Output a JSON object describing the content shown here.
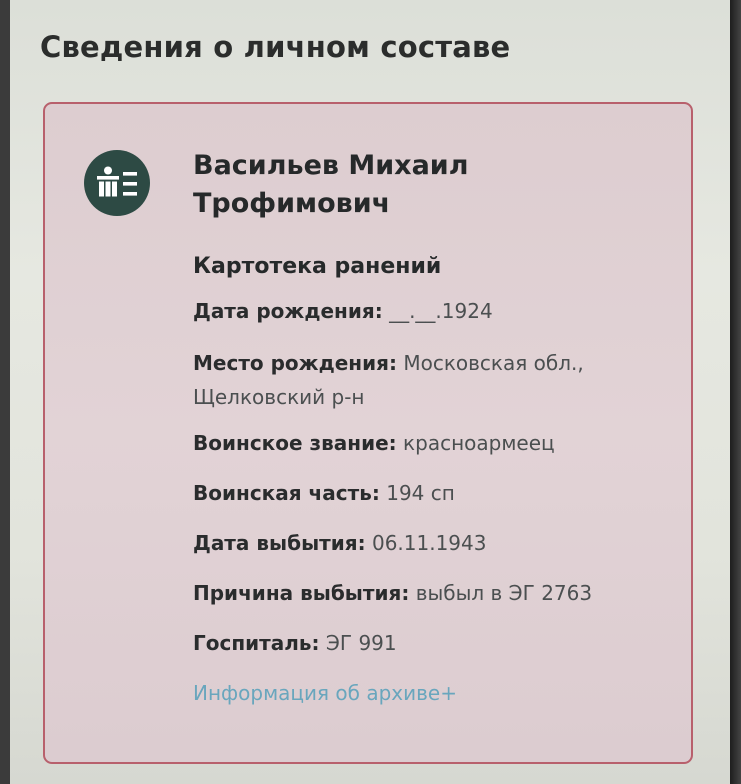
{
  "page": {
    "title": "Сведения о личном составе"
  },
  "card": {
    "avatar_icon": "person-card-icon",
    "name": "Васильев Михаил Трофимович",
    "source": "Картотека ранений",
    "fields": [
      {
        "label": "Дата рождения:",
        "value": "__.__.1924"
      },
      {
        "label": "Место рождения:",
        "value": "Московская обл., Щелковский р-н"
      },
      {
        "label": "Воинское звание:",
        "value": "красноармеец"
      },
      {
        "label": "Воинская часть:",
        "value": "194 сп"
      },
      {
        "label": "Дата выбытия:",
        "value": "06.11.1943"
      },
      {
        "label": "Причина выбытия:",
        "value": "выбыл в ЭГ 2763"
      },
      {
        "label": "Госпиталь:",
        "value": "ЭГ 991"
      }
    ],
    "archive_link": "Информация об архиве+"
  },
  "colors": {
    "card_border": "#b8606c",
    "card_bg": "#e2d3d6",
    "avatar_bg": "#2d4a44",
    "link": "#69a6bd"
  }
}
